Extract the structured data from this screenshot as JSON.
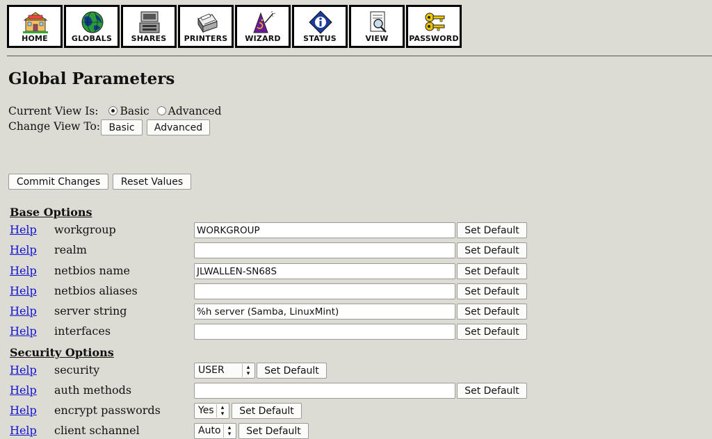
{
  "toolbar": [
    {
      "label": "HOME",
      "icon": "home-icon"
    },
    {
      "label": "GLOBALS",
      "icon": "globe-icon"
    },
    {
      "label": "SHARES",
      "icon": "shares-icon"
    },
    {
      "label": "PRINTERS",
      "icon": "printer-icon"
    },
    {
      "label": "WIZARD",
      "icon": "wizard-icon"
    },
    {
      "label": "STATUS",
      "icon": "info-icon"
    },
    {
      "label": "VIEW",
      "icon": "view-icon"
    },
    {
      "label": "PASSWORD",
      "icon": "keys-icon"
    }
  ],
  "page": {
    "title": "Global Parameters",
    "current_view_label": "Current View Is:",
    "view_basic": "Basic",
    "view_advanced": "Advanced",
    "current_view": "Basic",
    "change_view_label": "Change View To:",
    "change_basic_btn": "Basic",
    "change_advanced_btn": "Advanced",
    "commit_btn": "Commit Changes",
    "reset_btn": "Reset Values"
  },
  "base_options": {
    "heading": "Base Options",
    "rows": [
      {
        "help": "Help",
        "name": "workgroup",
        "value": "WORKGROUP",
        "default_btn": "Set Default"
      },
      {
        "help": "Help",
        "name": "realm",
        "value": "",
        "default_btn": "Set Default"
      },
      {
        "help": "Help",
        "name": "netbios name",
        "value": "JLWALLEN-SN68S",
        "default_btn": "Set Default"
      },
      {
        "help": "Help",
        "name": "netbios aliases",
        "value": "",
        "default_btn": "Set Default"
      },
      {
        "help": "Help",
        "name": "server string",
        "value": "%h server (Samba, LinuxMint)",
        "default_btn": "Set Default"
      },
      {
        "help": "Help",
        "name": "interfaces",
        "value": "",
        "default_btn": "Set Default"
      }
    ]
  },
  "security_options": {
    "heading": "Security Options",
    "rows": [
      {
        "help": "Help",
        "name": "security",
        "select_value": "USER",
        "default_btn": "Set Default"
      },
      {
        "help": "Help",
        "name": "auth methods",
        "value": "",
        "default_btn": "Set Default"
      },
      {
        "help": "Help",
        "name": "encrypt passwords",
        "select_value": "Yes",
        "default_btn": "Set Default"
      },
      {
        "help": "Help",
        "name": "client schannel",
        "select_value": "Auto",
        "default_btn": "Set Default"
      }
    ]
  },
  "colors": {
    "background": "#dcdcd4",
    "link": "#1010d0"
  }
}
